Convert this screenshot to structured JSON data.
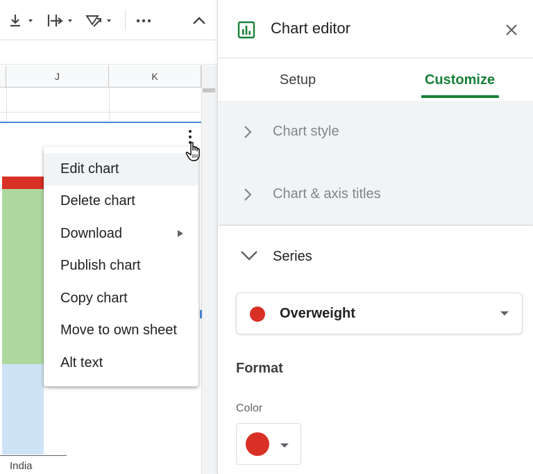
{
  "toolbar": {
    "icons": [
      "vertical-align-icon",
      "text-wrap-icon",
      "text-rotate-icon",
      "more-icon",
      "collapse-icon"
    ]
  },
  "sheet": {
    "columns": [
      "J",
      "K"
    ],
    "chart": {
      "axis_category": "India",
      "colors": {
        "overweight": "#d93025",
        "normal": "#aed8a0",
        "underweight": "#cfe3f7"
      }
    },
    "menu": {
      "items": [
        {
          "label": "Edit chart",
          "active": true
        },
        {
          "label": "Delete chart"
        },
        {
          "label": "Download",
          "submenu": true
        },
        {
          "label": "Publish chart"
        },
        {
          "label": "Copy chart"
        },
        {
          "label": "Move to own sheet"
        },
        {
          "label": "Alt text"
        }
      ]
    }
  },
  "editor": {
    "title": "Chart editor",
    "tabs": [
      {
        "label": "Setup",
        "selected": false
      },
      {
        "label": "Customize",
        "selected": true
      }
    ],
    "sections": {
      "chart_style": "Chart style",
      "chart_axis_titles": "Chart & axis titles",
      "series": "Series"
    },
    "series_select": {
      "value": "Overweight",
      "color": "#d93025"
    },
    "format_label": "Format",
    "color_label": "Color",
    "color_value": "#d93025",
    "accent_color": "#188038"
  }
}
